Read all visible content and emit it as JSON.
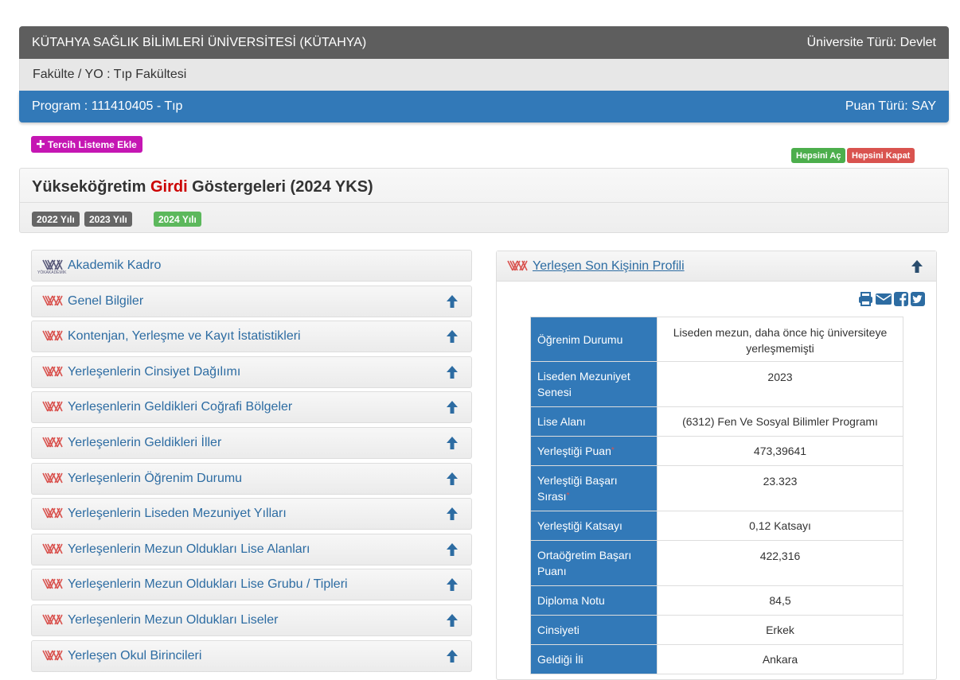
{
  "header": {
    "university": "KÜTAHYA SAĞLIK BİLİMLERİ ÜNİVERSİTESİ (KÜTAHYA)",
    "university_type": "Üniversite Türü: Devlet",
    "faculty": "Fakülte / YO : Tıp Fakültesi",
    "program": "Program : 111410405 - Tıp",
    "score_type": "Puan Türü: SAY"
  },
  "actions": {
    "add_to_list": "Tercih Listeme Ekle",
    "expand_all": "Hepsini Aç",
    "collapse_all": "Hepsini Kapat"
  },
  "indicators": {
    "title_pre": "Yükseköğretim ",
    "title_highlight": "Girdi",
    "title_post": " Göstergeleri (2024 YKS)",
    "years": [
      "2022 Yılı",
      "2023 Yılı",
      "2024 Yılı"
    ]
  },
  "sidebar": {
    "items": [
      {
        "label": "Akademik Kadro",
        "logo_text": "YÖKAKADEMİK"
      },
      {
        "label": "Genel Bilgiler"
      },
      {
        "label": "Kontenjan, Yerleşme ve Kayıt İstatistikleri"
      },
      {
        "label": "Yerleşenlerin Cinsiyet Dağılımı"
      },
      {
        "label": "Yerleşenlerin Geldikleri Coğrafi Bölgeler"
      },
      {
        "label": "Yerleşenlerin Geldikleri İller"
      },
      {
        "label": "Yerleşenlerin Öğrenim Durumu"
      },
      {
        "label": "Yerleşenlerin Liseden Mezuniyet Yılları"
      },
      {
        "label": "Yerleşenlerin Mezun Oldukları Lise Alanları"
      },
      {
        "label": "Yerleşenlerin Mezun Oldukları Lise Grubu / Tipleri"
      },
      {
        "label": "Yerleşenlerin Mezun Oldukları Liseler"
      },
      {
        "label": "Yerleşen Okul Birincileri"
      }
    ]
  },
  "profile": {
    "title": "Yerleşen Son Kişinin Profili",
    "rows": [
      {
        "key": "Öğrenim Durumu",
        "value": "Liseden mezun, daha önce hiç üniversiteye yerleşmemişti"
      },
      {
        "key": "Liseden Mezuniyet Senesi",
        "value": "2023"
      },
      {
        "key": "Lise Alanı",
        "value": "(6312) Fen Ve Sosyal Bilimler Programı"
      },
      {
        "key": "Yerleştiği Puan",
        "value": "473,39641",
        "required_mark": "*"
      },
      {
        "key": "Yerleştiği Başarı Sırası",
        "value": "23.323",
        "required_mark": "*"
      },
      {
        "key": "Yerleştiği Katsayı",
        "value": "0,12 Katsayı"
      },
      {
        "key": "Ortaöğretim Başarı Puanı",
        "value": "422,316"
      },
      {
        "key": "Diploma Notu",
        "value": "84,5"
      },
      {
        "key": "Cinsiyeti",
        "value": "Erkek"
      },
      {
        "key": "Geldiği İli",
        "value": "Ankara"
      }
    ]
  },
  "colors": {
    "header_dark": "#5e5e5e",
    "program_blue": "#3279b8",
    "tercih_magenta": "#c516b3",
    "green": "#5cb85c",
    "red": "#d9534f",
    "link_blue": "#2d6ca2"
  },
  "icons": {
    "plus": "plus-icon",
    "yok_logo": "yok-logo-icon",
    "arrow_up": "arrow-up-icon",
    "print": "print-icon",
    "email": "envelope-icon",
    "facebook": "facebook-icon",
    "twitter": "twitter-icon"
  }
}
